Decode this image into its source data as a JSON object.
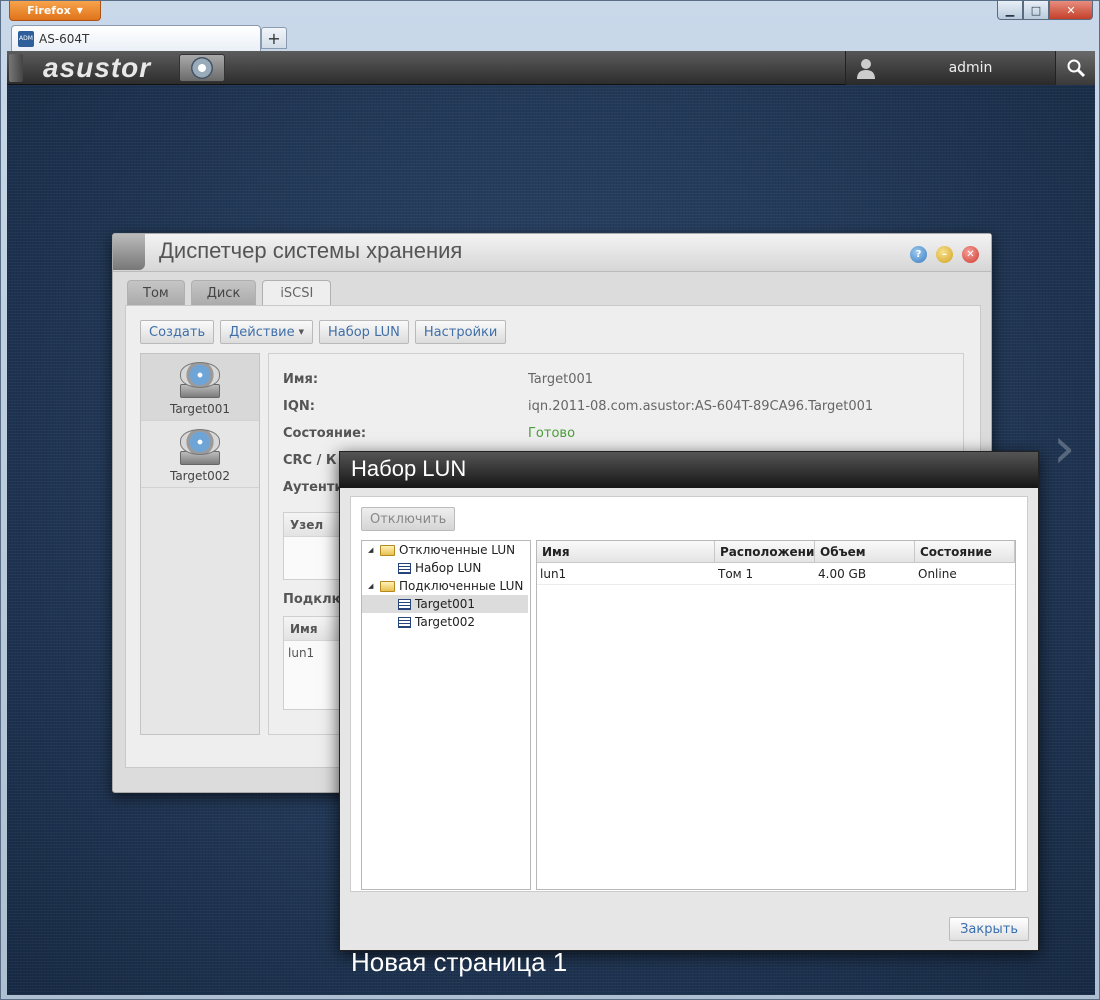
{
  "browser": {
    "menu_button": "Firefox",
    "tab_title": "AS-604T",
    "favicon_text": "ADM",
    "new_tab": "+",
    "controls": {
      "minimize": "▁",
      "maximize": "□",
      "close": "✕"
    }
  },
  "topbar": {
    "logo": "asustor",
    "user": "admin"
  },
  "page_caption": "Новая страница 1",
  "storage_manager": {
    "title": "Диспетчер системы хранения",
    "tabs": [
      {
        "label": "Том",
        "active": false
      },
      {
        "label": "Диск",
        "active": false
      },
      {
        "label": "iSCSI",
        "active": true
      }
    ],
    "toolbar": {
      "create": "Создать",
      "action": "Действие",
      "lun_set": "Набор LUN",
      "settings": "Настройки"
    },
    "targets": [
      {
        "label": "Target001",
        "selected": true
      },
      {
        "label": "Target002",
        "selected": false
      }
    ],
    "details": {
      "name_label": "Имя:",
      "name_value": "Target001",
      "iqn_label": "IQN:",
      "iqn_value": "iqn.2011-08.com.asustor:AS-604T-89CA96.Target001",
      "state_label": "Состояние:",
      "state_value": "Готово",
      "crc_label": "CRC / К",
      "auth_label": "Аутенти",
      "node_header": "Узел",
      "connected_label": "Подклю",
      "lun_name_header": "Имя",
      "lun_row": "lun1"
    }
  },
  "lun_dialog": {
    "title": "Набор LUN",
    "disconnect_button": "Отключить",
    "tree": {
      "disconnected_group": "Отключенные LUN",
      "disconnected_item": "Набор LUN",
      "connected_group": "Подключенные LUN",
      "connected_items": [
        "Target001",
        "Target002"
      ]
    },
    "columns": [
      "Имя",
      "Расположение",
      "Объем",
      "Состояние"
    ],
    "rows": [
      {
        "name": "lun1",
        "location": "Том 1",
        "size": "4.00 GB",
        "status": "Online"
      }
    ],
    "close_button": "Закрыть"
  },
  "colors": {
    "status_ok": "#4a9d3a",
    "link_blue": "#3f6fa8",
    "accent_orange": "#e0731a"
  }
}
